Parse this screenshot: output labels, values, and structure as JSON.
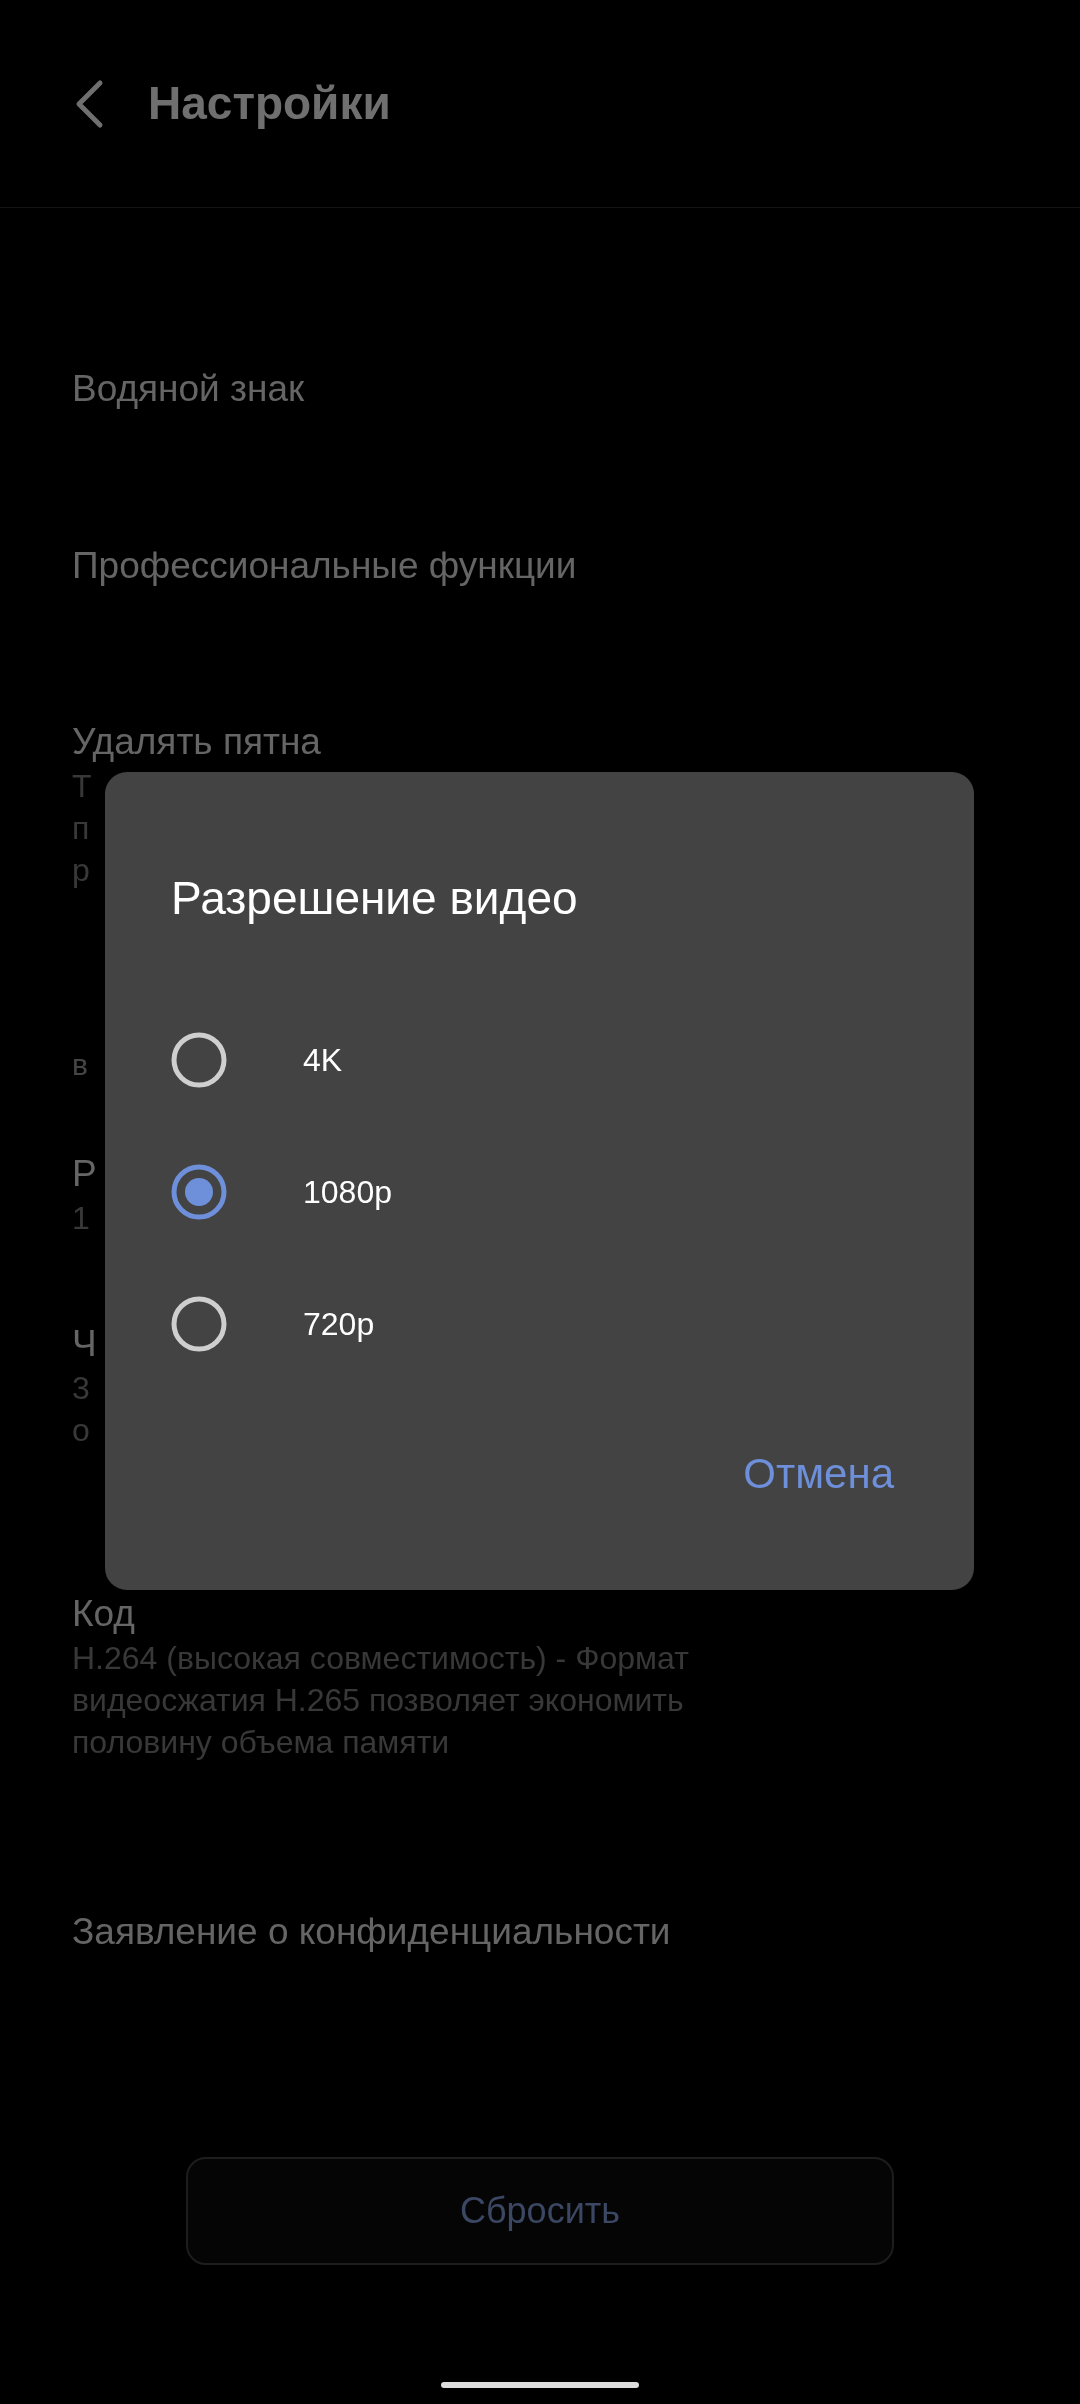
{
  "header": {
    "title": "Настройки"
  },
  "settings": [
    {
      "kind": "item",
      "title": "Водяной знак"
    },
    {
      "kind": "item",
      "title": "Профессиональные функции"
    },
    {
      "kind": "item",
      "title": "Удалять пятна",
      "lines": [
        "Т",
        "п",
        "р"
      ]
    },
    {
      "kind": "section",
      "title": "в"
    },
    {
      "kind": "item",
      "title": "Р",
      "lines": [
        "1"
      ]
    },
    {
      "kind": "item",
      "title": "Ч",
      "lines": [
        "3",
        "о"
      ]
    },
    {
      "kind": "item",
      "title": "Код",
      "lines": [
        "H.264 (высокая совместимость) - Формат видеосжатия H.265 позволяет экономить половину объема памяти"
      ]
    },
    {
      "kind": "item",
      "title": "Заявление о конфиденциальности"
    }
  ],
  "reset_button": "Сбросить",
  "dialog": {
    "title": "Разрешение видео",
    "options": [
      {
        "label": "4K",
        "selected": false
      },
      {
        "label": "1080p",
        "selected": true
      },
      {
        "label": "720p",
        "selected": false
      }
    ],
    "cancel": "Отмена"
  }
}
